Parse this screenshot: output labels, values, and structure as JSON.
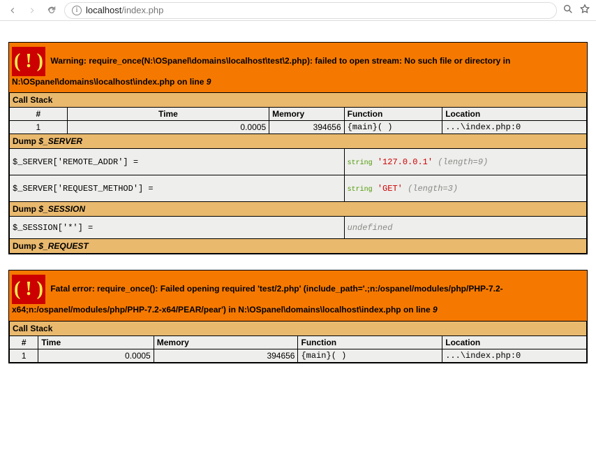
{
  "browser": {
    "url_host": "localhost",
    "url_path": "/index.php"
  },
  "errors": [
    {
      "badge": "( ! )",
      "type": "Warning:",
      "message_a": "require_once(N:\\OSpanel\\domains\\localhost\\test\\2.php): failed to open stream: No such file or directory in",
      "message_b": "N:\\OSpanel\\domains\\localhost\\index.php on line",
      "line_no": "9",
      "call_stack_label": "Call Stack",
      "columns": {
        "num": "#",
        "time": "Time",
        "memory": "Memory",
        "function": "Function",
        "location": "Location"
      },
      "stack": [
        {
          "num": "1",
          "time": "0.0005",
          "memory": "394656",
          "function": "{main}( )",
          "location": "...\\index.php:0"
        }
      ],
      "dumps": [
        {
          "title_prefix": "Dump",
          "title_var": "$_SERVER",
          "rows": [
            {
              "key": "$_SERVER['REMOTE_ADDR'] =",
              "kw": "string",
              "str": "'127.0.0.1'",
              "len": "(length=9)"
            },
            {
              "key": "$_SERVER['REQUEST_METHOD'] =",
              "kw": "string",
              "str": "'GET'",
              "len": "(length=3)"
            }
          ]
        },
        {
          "title_prefix": "Dump",
          "title_var": "$_SESSION",
          "rows": [
            {
              "key": "$_SESSION['*'] =",
              "undef": "undefined"
            }
          ]
        },
        {
          "title_prefix": "Dump",
          "title_var": "$_REQUEST",
          "rows": []
        }
      ]
    },
    {
      "badge": "( ! )",
      "type": "Fatal error:",
      "message_a": "require_once(): Failed opening required 'test/2.php' (include_path='.;n:/ospanel/modules/php/PHP-7.2-x64;n:/ospanel/modules/php/PHP-7.2-x64/PEAR/pear') in N:\\OSpanel\\domains\\localhost\\index.php on line",
      "message_b": "",
      "line_no": "9",
      "call_stack_label": "Call Stack",
      "columns": {
        "num": "#",
        "time": "Time",
        "memory": "Memory",
        "function": "Function",
        "location": "Location"
      },
      "stack": [
        {
          "num": "1",
          "time": "0.0005",
          "memory": "394656",
          "function": "{main}( )",
          "location": "...\\index.php:0"
        }
      ],
      "dumps": []
    }
  ]
}
